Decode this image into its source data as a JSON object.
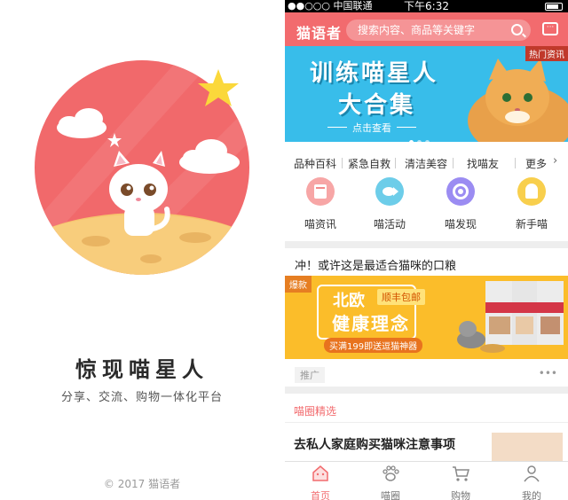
{
  "splash": {
    "title": "惊现喵星人",
    "subtitle": "分享、交流、购物一体化平台",
    "copyright": "© 2017  猫语者"
  },
  "status_bar": {
    "carrier": "●●○○○ 中国联通",
    "time": "下午6:32"
  },
  "header": {
    "logo": "猫语者",
    "search_placeholder": "搜索内容、商品等关键字",
    "accent": "#f26b6e"
  },
  "banner": {
    "title_line1": "训练喵星人",
    "title_line2": "大合集",
    "cta": "点击查看",
    "tag": "热门资讯"
  },
  "categories": {
    "items": [
      "品种百科",
      "紧急自救",
      "清洁美容",
      "找喵友"
    ],
    "more": "更多"
  },
  "quick_links": [
    {
      "label": "喵资讯",
      "icon": "news-icon",
      "color": "#f28b8b"
    },
    {
      "label": "喵活动",
      "icon": "fish-icon",
      "color": "#5ac8e8"
    },
    {
      "label": "喵发现",
      "icon": "target-icon",
      "color": "#8e7cf0"
    },
    {
      "label": "新手喵",
      "icon": "ghost-icon",
      "color": "#f7c844"
    }
  ],
  "feed": {
    "post_title": "冲！或许这是最适合猫咪的口粮",
    "ad_tag": "爆款",
    "ad_line1": "北欧",
    "ad_badge": "顺丰包邮",
    "ad_line2": "健康理念",
    "ad_promo": "买满199即送逗猫神器",
    "sponsored": "推广",
    "more": "•••"
  },
  "section": {
    "heading": "喵圈精选",
    "article_title": "去私人家庭购买猫咪注意事项"
  },
  "tabbar": [
    {
      "label": "首页",
      "icon": "home-icon",
      "active": true
    },
    {
      "label": "喵圈",
      "icon": "paw-icon",
      "active": false
    },
    {
      "label": "购物",
      "icon": "cart-icon",
      "active": false
    },
    {
      "label": "我的",
      "icon": "user-icon",
      "active": false
    }
  ]
}
